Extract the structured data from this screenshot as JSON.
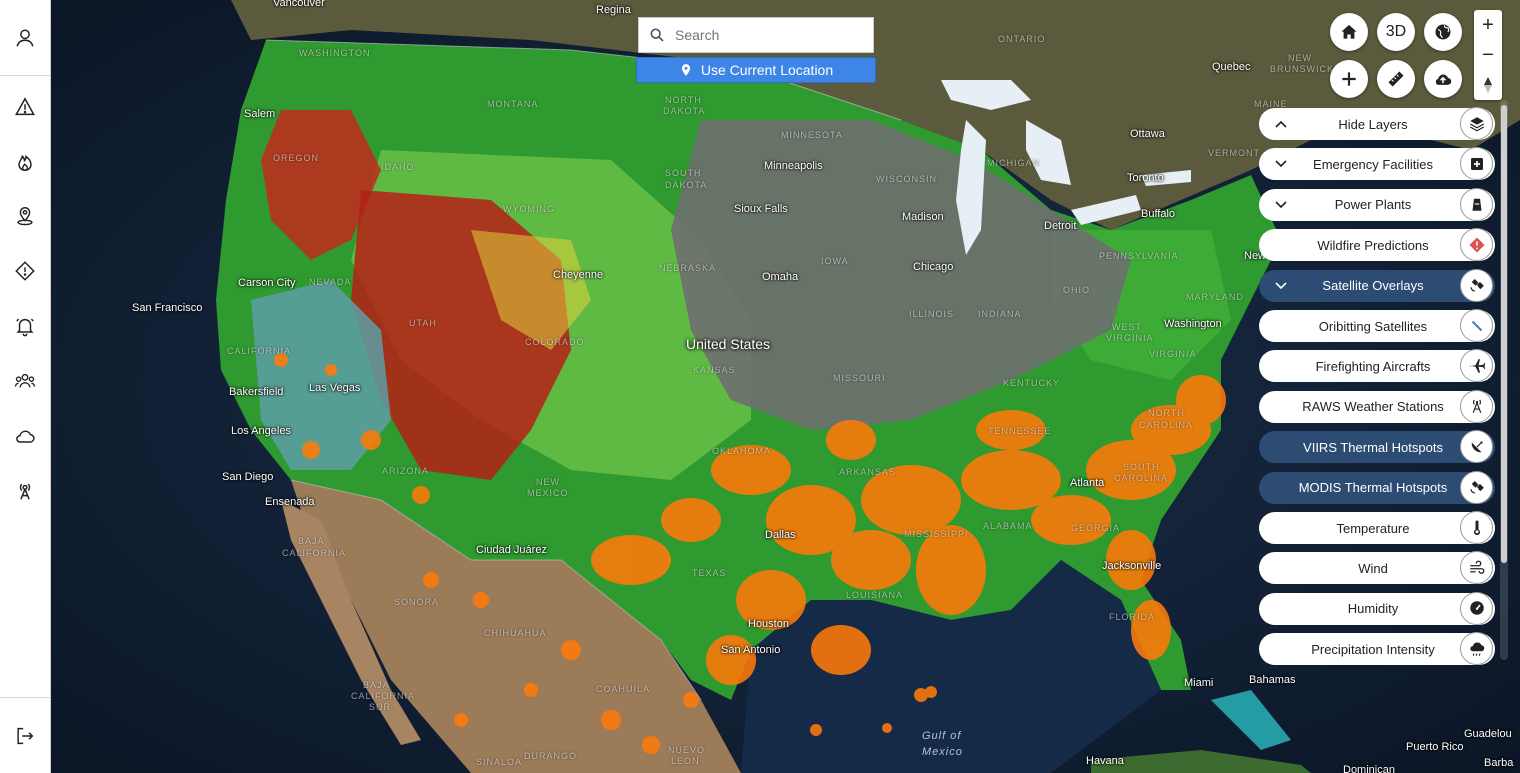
{
  "search": {
    "placeholder": "Search",
    "value": ""
  },
  "location_button": {
    "label": "Use Current Location"
  },
  "toolbar": {
    "three_d_label": "3D"
  },
  "zoom": {
    "in_label": "+",
    "out_label": "−"
  },
  "layers": [
    {
      "label": "Hide Layers",
      "chevron": "up",
      "active": false,
      "icon": "layers-icon"
    },
    {
      "label": "Emergency Facilities",
      "chevron": "down",
      "active": false,
      "icon": "hospital-icon"
    },
    {
      "label": "Power Plants",
      "chevron": "down",
      "active": false,
      "icon": "power-plant-icon"
    },
    {
      "label": "Wildfire Predictions",
      "chevron": "",
      "active": false,
      "icon": "warning-diamond-icon"
    },
    {
      "label": "Satellite Overlays",
      "chevron": "down",
      "active": true,
      "icon": "satellite-icon"
    },
    {
      "label": "Oribitting Satellites",
      "chevron": "",
      "active": false,
      "icon": "orbit-satellite-icon"
    },
    {
      "label": "Firefighting Aircrafts",
      "chevron": "",
      "active": false,
      "icon": "airplane-icon"
    },
    {
      "label": "RAWS Weather Stations",
      "chevron": "",
      "active": false,
      "icon": "antenna-icon"
    },
    {
      "label": "VIIRS Thermal Hotspots",
      "chevron": "",
      "active": true,
      "icon": "satellite-dish-icon"
    },
    {
      "label": "MODIS Thermal Hotspots",
      "chevron": "",
      "active": true,
      "icon": "satellite-icon"
    },
    {
      "label": "Temperature",
      "chevron": "",
      "active": false,
      "icon": "thermometer-icon"
    },
    {
      "label": "Wind",
      "chevron": "",
      "active": false,
      "icon": "wind-icon"
    },
    {
      "label": "Humidity",
      "chevron": "",
      "active": false,
      "icon": "gauge-icon"
    },
    {
      "label": "Precipitation Intensity",
      "chevron": "",
      "active": false,
      "icon": "rain-cloud-icon"
    }
  ],
  "map": {
    "country": "United States",
    "water": {
      "gulf_line1": "Gulf of",
      "gulf_line2": "Mexico"
    },
    "cities": {
      "vancouver": "Vancouver",
      "regina": "Regina",
      "salem": "Salem",
      "san_francisco": "San Francisco",
      "carson_city": "Carson City",
      "bakersfield": "Bakersfield",
      "las_vegas": "Las Vegas",
      "los_angeles": "Los Angeles",
      "san_diego": "San Diego",
      "ensenada": "Ensenada",
      "cheyenne": "Cheyenne",
      "ciudad_juarez": "Ciudad Juárez",
      "minneapolis": "Minneapolis",
      "sioux_falls": "Sioux Falls",
      "omaha": "Omaha",
      "madison": "Madison",
      "chicago": "Chicago",
      "detroit": "Detroit",
      "toronto": "Toronto",
      "buffalo": "Buffalo",
      "ottawa": "Ottawa",
      "quebec": "Quebec",
      "new_york": "New York",
      "washington": "Washington",
      "dallas": "Dallas",
      "houston": "Houston",
      "san_antonio": "San Antonio",
      "atlanta": "Atlanta",
      "jacksonville": "Jacksonville",
      "miami": "Miami",
      "bahamas": "Bahamas",
      "havana": "Havana",
      "puerto_rico": "Puerto Rico",
      "dominican": "Dominican",
      "guadelou": "Guadelou",
      "barba": "Barba"
    },
    "regions": {
      "washington": "WASHINGTON",
      "oregon": "OREGON",
      "idaho": "IDAHO",
      "montana": "MONTANA",
      "north_dakota_1": "NORTH",
      "north_dakota_2": "DAKOTA",
      "south_dakota_1": "SOUTH",
      "south_dakota_2": "DAKOTA",
      "wyoming": "WYOMING",
      "nevada": "NEVADA",
      "utah": "UTAH",
      "colorado": "COLORADO",
      "california": "CALIFORNIA",
      "arizona": "ARIZONA",
      "new_mexico_1": "NEW",
      "new_mexico_2": "MEXICO",
      "nebraska": "NEBRASKA",
      "kansas": "KANSAS",
      "oklahoma": "OKLAHOMA",
      "texas": "TEXAS",
      "iowa": "IOWA",
      "minnesota": "MINNESOTA",
      "wisconsin": "WISCONSIN",
      "michigan": "MICHIGAN",
      "illinois": "ILLINOIS",
      "indiana": "INDIANA",
      "ohio": "OHIO",
      "missouri": "MISSOURI",
      "arkansas": "ARKANSAS",
      "louisiana": "LOUISIANA",
      "mississippi": "MISSISSIPPI",
      "alabama": "ALABAMA",
      "georgia": "GEORGIA",
      "tennessee": "TENNESSEE",
      "kentucky": "KENTUCKY",
      "west_virginia_1": "WEST",
      "west_virginia_2": "VIRGINIA",
      "virginia": "VIRGINIA",
      "north_carolina_1": "NORTH",
      "north_carolina_2": "CAROLINA",
      "south_carolina_1": "SOUTH",
      "south_carolina_2": "CAROLINA",
      "florida": "FLORIDA",
      "pennsylvania": "PENNSYLVANIA",
      "maryland": "MARYLAND",
      "vermont": "VERMONT",
      "maine": "MAINE",
      "new_brunswick_1": "NEW",
      "new_brunswick_2": "BRUNSWICK",
      "ontario": "ONTARIO",
      "sonora": "SONORA",
      "chihuahua": "CHIHUAHUA",
      "coahuila": "COAHUILA",
      "baja_california_1": "BAJA",
      "baja_california_2": "CALIFORNIA",
      "baja_california_sur_1": "BAJA",
      "baja_california_sur_2": "CALIFORNIA",
      "baja_california_sur_3": "SUR",
      "durango": "DURANGO",
      "sinaloa": "SINALOA",
      "nuevo_leon_1": "NUEVO",
      "nuevo_leon_2": "LEON"
    }
  },
  "colors": {
    "vegetation": "#2f9a2f",
    "dry": "#c2291b",
    "hotspot": "#ff7a0a",
    "active_layer": "#2d4c73",
    "location_button": "#3d86e8"
  }
}
